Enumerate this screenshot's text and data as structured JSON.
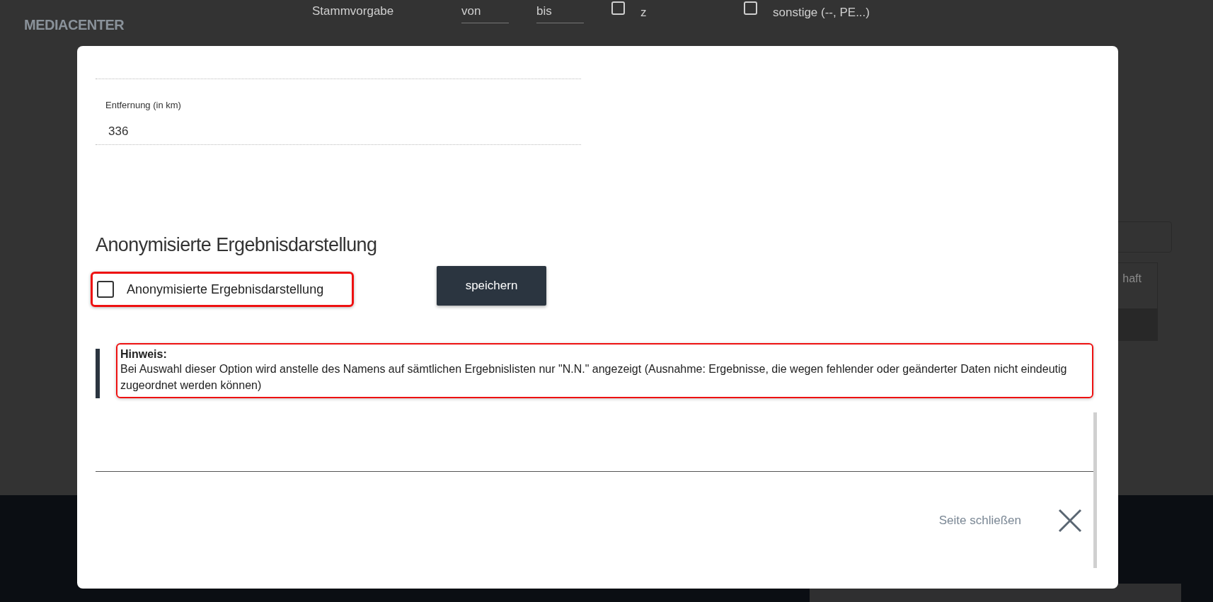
{
  "background": {
    "logo": "MEDIACENTER",
    "filter": {
      "label": "Stammvorgabe",
      "from": {
        "placeholder": "von"
      },
      "to": {
        "placeholder": "bis"
      },
      "options": [
        {
          "label": "z",
          "checked": false
        },
        {
          "label": "sonstige (--, PE...)",
          "checked": false
        }
      ]
    },
    "table": {
      "columns": [
        "haft"
      ]
    }
  },
  "dialog": {
    "fields": [
      {
        "label": "Entfernung (in km)",
        "value": "336"
      }
    ],
    "section_title": "Anonymisierte Ergebnisdarstellung",
    "option": {
      "label": "Anonymisierte Ergebnisdarstellung",
      "checked": false
    },
    "save_button": "speichern",
    "hint": {
      "title": "Hinweis:",
      "text": "Bei Auswahl dieser Option wird anstelle des Namens auf sämtlichen Ergebnislisten nur \"N.N.\" angezeigt (Ausnahme: Ergebnisse, die wegen fehlender oder geänderter Daten nicht eindeutig zugeordnet werden können)"
    },
    "close_label": "Seite schließen"
  }
}
